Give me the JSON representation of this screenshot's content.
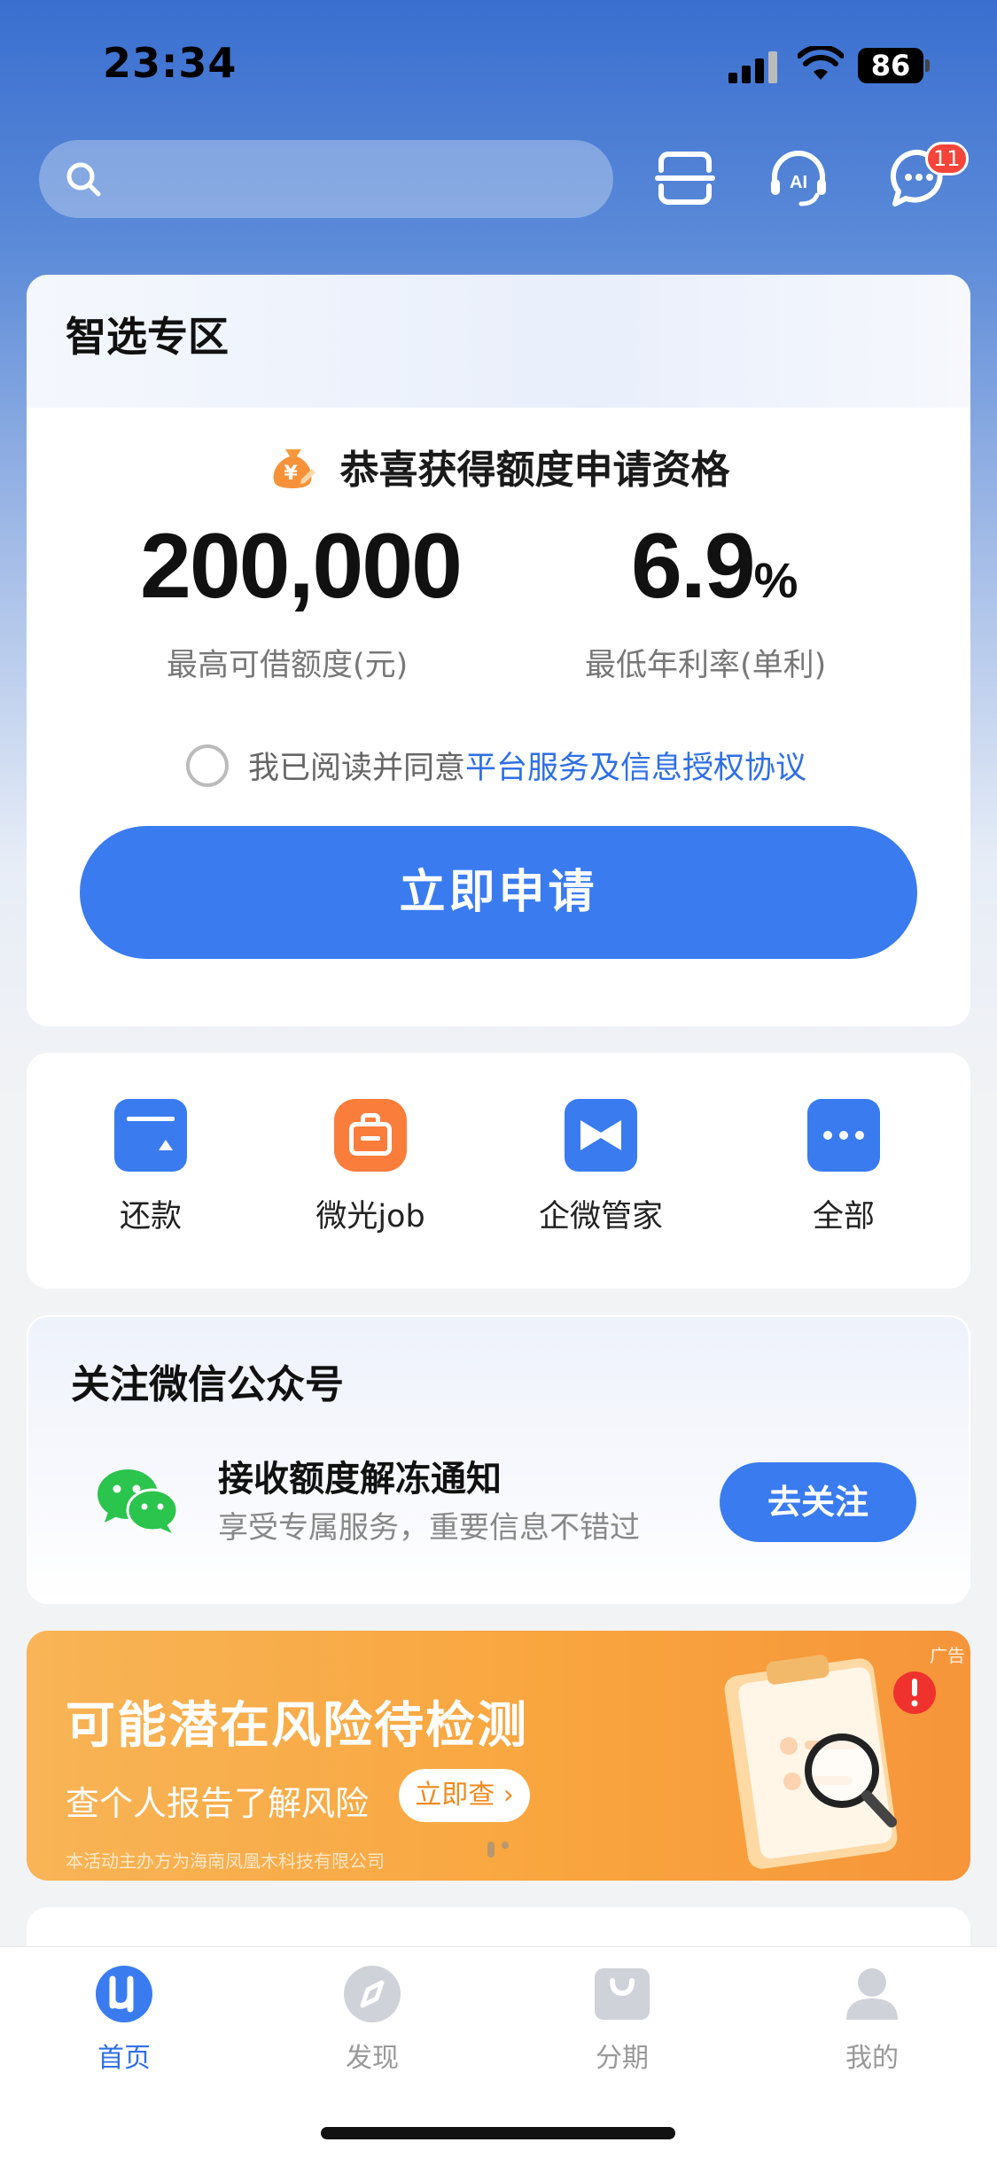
{
  "status_bar": {
    "time": "23:34",
    "battery": "86"
  },
  "header": {
    "search_placeholder": "",
    "icons": [
      "search-icon",
      "scan-icon",
      "ai-service-icon",
      "message-icon"
    ],
    "message_badge": "11"
  },
  "loan_card": {
    "title": "智选专区",
    "congrats": "恭喜获得额度申请资格",
    "max_amount": "200,000",
    "max_amount_label": "最高可借额度(元)",
    "min_rate": "6.9",
    "min_rate_unit": "%",
    "min_rate_label": "最低年利率(单利)",
    "agree_prefix": "我已阅读并同意",
    "agree_link": "平台服务及信息授权协议",
    "apply_button": "立即申请"
  },
  "quick_actions": [
    {
      "label": "还款",
      "icon": "repay-icon",
      "color": "#3a7bf0"
    },
    {
      "label": "微光job",
      "icon": "briefcase-icon",
      "color": "#fa7d3c"
    },
    {
      "label": "企微管家",
      "icon": "bowtie-icon",
      "color": "#3a7bf0"
    },
    {
      "label": "全部",
      "icon": "more-icon",
      "color": "#3a7bf0"
    }
  ],
  "wechat_card": {
    "title": "关注微信公众号",
    "headline": "接收额度解冻通知",
    "subline": "享受专属服务，重要信息不错过",
    "follow_button": "去关注"
  },
  "ad_banner": {
    "tag": "广告",
    "title": "可能潜在风险待检测",
    "subtitle": "查个人报告了解风险",
    "button": "立即查",
    "footer": "本活动主办方为海南凤凰木科技有限公司"
  },
  "tabbar": [
    {
      "label": "首页",
      "active": true
    },
    {
      "label": "发现",
      "active": false
    },
    {
      "label": "分期",
      "active": false
    },
    {
      "label": "我的",
      "active": false
    }
  ],
  "colors": {
    "accent": "#3a7bf0",
    "badge": "#f5453a",
    "ad": "#f9a63f"
  }
}
